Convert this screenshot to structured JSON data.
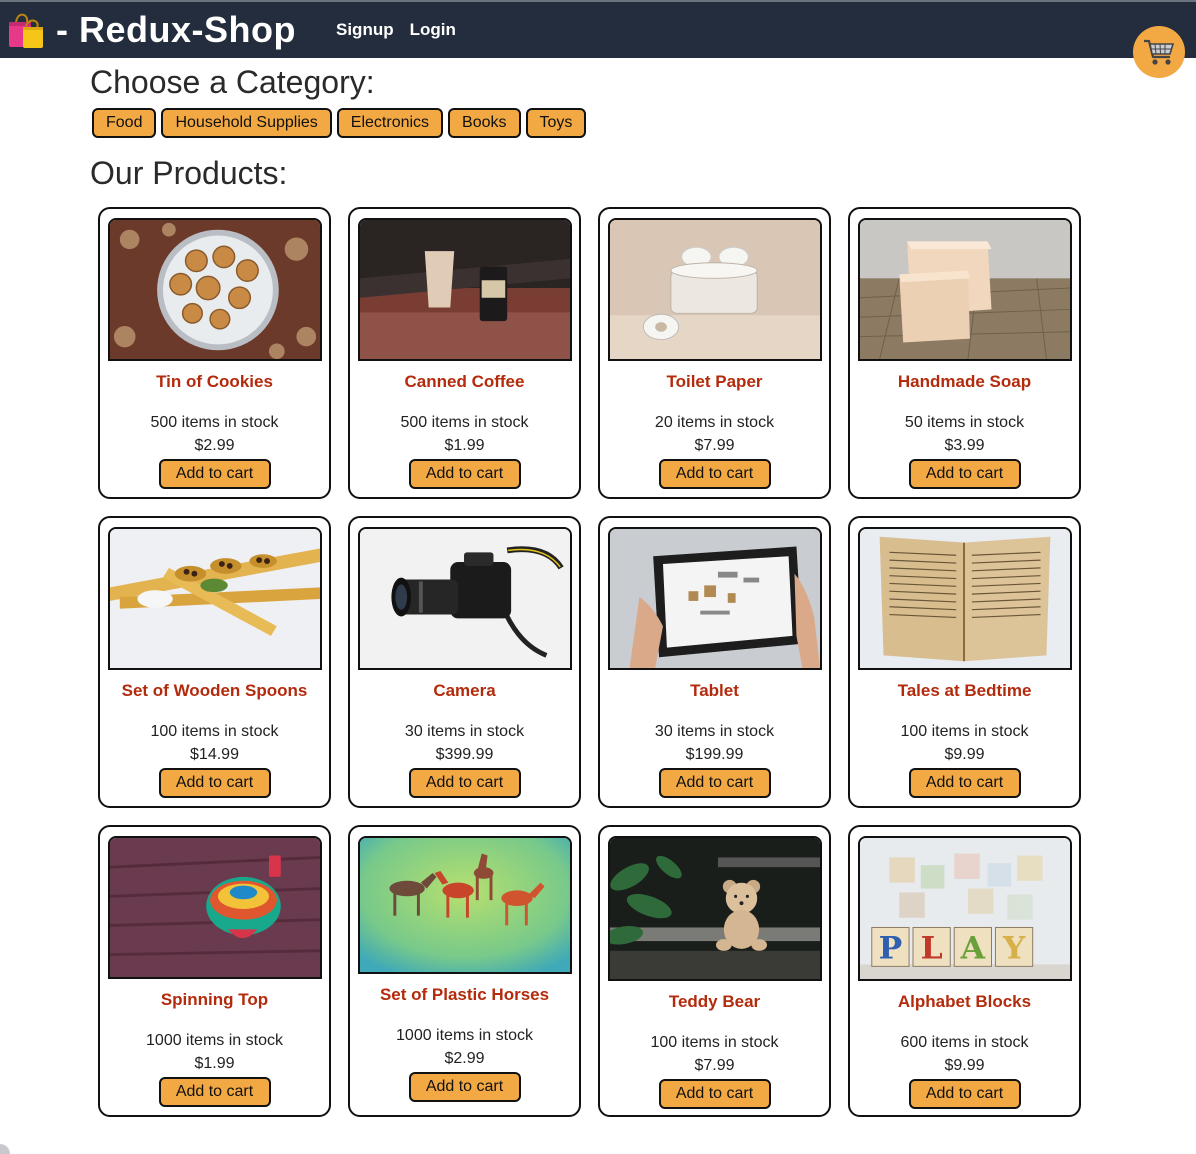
{
  "header": {
    "brand_emoji_icon": "shopping-bags-icon",
    "brand_title": "- Redux-Shop",
    "nav": [
      "Signup",
      "Login"
    ],
    "cart_icon": "shopping-cart-icon",
    "colors": {
      "navbar": "#232d3d",
      "accent": "#f3a943",
      "product_name": "#b32b0c"
    }
  },
  "category_heading": "Choose a Category:",
  "categories": [
    "Food",
    "Household Supplies",
    "Electronics",
    "Books",
    "Toys"
  ],
  "products_heading": "Our Products:",
  "products": [
    {
      "name": "Tin of Cookies",
      "stock": "500 items in stock",
      "price": "$2.99",
      "button": "Add to cart",
      "image": "cookies-tin-image"
    },
    {
      "name": "Canned Coffee",
      "stock": "500 items in stock",
      "price": "$1.99",
      "button": "Add to cart",
      "image": "canned-coffee-image"
    },
    {
      "name": "Toilet Paper",
      "stock": "20 items in stock",
      "price": "$7.99",
      "button": "Add to cart",
      "image": "toilet-paper-image"
    },
    {
      "name": "Handmade Soap",
      "stock": "50 items in stock",
      "price": "$3.99",
      "button": "Add to cart",
      "image": "soap-image"
    },
    {
      "name": "Set of Wooden Spoons",
      "stock": "100 items in stock",
      "price": "$14.99",
      "button": "Add to cart",
      "image": "wooden-spoons-image"
    },
    {
      "name": "Camera",
      "stock": "30 items in stock",
      "price": "$399.99",
      "button": "Add to cart",
      "image": "camera-image"
    },
    {
      "name": "Tablet",
      "stock": "30 items in stock",
      "price": "$199.99",
      "button": "Add to cart",
      "image": "tablet-image"
    },
    {
      "name": "Tales at Bedtime",
      "stock": "100 items in stock",
      "price": "$9.99",
      "button": "Add to cart",
      "image": "book-image"
    },
    {
      "name": "Spinning Top",
      "stock": "1000 items in stock",
      "price": "$1.99",
      "button": "Add to cart",
      "image": "spinning-top-image"
    },
    {
      "name": "Set of Plastic Horses",
      "stock": "1000 items in stock",
      "price": "$2.99",
      "button": "Add to cart",
      "image": "plastic-horses-image"
    },
    {
      "name": "Teddy Bear",
      "stock": "100 items in stock",
      "price": "$7.99",
      "button": "Add to cart",
      "image": "teddy-bear-image"
    },
    {
      "name": "Alphabet Blocks",
      "stock": "600 items in stock",
      "price": "$9.99",
      "button": "Add to cart",
      "image": "alphabet-blocks-image"
    }
  ]
}
